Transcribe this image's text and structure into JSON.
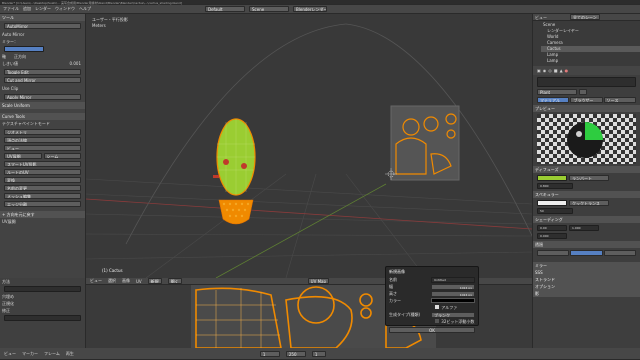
{
  "window": {
    "title": "Blender* [C:\\Users\\...\\Desktop\\Sushi\\... 実写合成用\\Blender用素材\\blend\\Blender\\Blender\\Cactus\\...\\cactus_shading.blend]"
  },
  "topbar": {
    "menus": [
      "ファイル",
      "追加",
      "レンダー",
      "ウィンドウ",
      "ヘルプ"
    ],
    "screen": "Default",
    "scene": "Scene",
    "engine": "Blenderレンダー"
  },
  "left_panel": {
    "header": "ツール",
    "btn_top": "AutoMirror",
    "auto_mirror": "Auto Mirror",
    "mirror_field": "ミラー：",
    "axis_label": "軸",
    "orientation": "正方向",
    "threshold_label": "しきい値",
    "threshold_val": "0.001",
    "toggle_edit": "Toggle Edit",
    "cut_mirror": "Cut and Mirror",
    "use_clip": "Use Clip",
    "apply_mirror": "Apply Mirror",
    "sections": [
      "Scale Uniform",
      "Curve Tools",
      "テクスチャペイントモード"
    ],
    "items": [
      "ジオメトリ",
      "頂点の法線",
      "ビュー",
      "UV展開",
      "シーム",
      "スマートUV投影",
      "ルートのUV",
      "変換",
      "名前の変更",
      "メッシュ編集",
      "エッジ分離"
    ],
    "footer": "+ 方向を元に戻す",
    "last_op": "UV展開",
    "props": [
      "方法",
      "穴埋め",
      "正規化",
      "修正",
      "マージン"
    ]
  },
  "viewport": {
    "header": "ユーザー・平行投影",
    "subheader": "Meters",
    "object_label": "(1) Cactus"
  },
  "right_panel": {
    "header": "ビュー",
    "layer_btn": "全てのシーン",
    "outliner": [
      "Scene",
      "レンダーレイヤー",
      "World",
      "Camera",
      "Cactus",
      "Lamp",
      "Lamp"
    ],
    "material": "Plant",
    "tabs": [
      "マテリアル",
      "ブラウザー",
      "ソース"
    ],
    "preview": "プレビュー",
    "sections": [
      "ディフューズ",
      "スペキュラー",
      "シェーディング",
      "透過",
      "ミラー",
      "SSS",
      "ストランド",
      "オプション",
      "影"
    ],
    "diffuse_shader": "ランバート",
    "specular_shader": "クックトランス",
    "intensity": "0.800",
    "hardness": "50",
    "emit": "0.00",
    "ambient": "1.000",
    "translucency": "0.000"
  },
  "uv_header": {
    "items": [
      "ビュー",
      "選択",
      "画像",
      "UV",
      "新規",
      "開く",
      "UV Map"
    ]
  },
  "popup": {
    "title": "新規画像",
    "name_label": "名前",
    "name_val": "Untitled",
    "width_label": "幅",
    "width_val": "1024 px",
    "height_label": "高さ",
    "height_val": "1024 px",
    "color_label": "カラー",
    "alpha_label": "アルファ",
    "type_label": "生成タイプ(種類)",
    "type_val": "ブランク",
    "float_label": "32ビット浮動小数",
    "ok": "OK"
  },
  "bottom_timeline": {
    "items": [
      "ビュー",
      "マーカー",
      "フレーム",
      "再生"
    ],
    "start": "1",
    "end": "250",
    "current": "1"
  },
  "colors": {
    "accent": "#5680c2",
    "orange": "#f08a00",
    "green": "#9acd32",
    "bg": "#393939"
  }
}
